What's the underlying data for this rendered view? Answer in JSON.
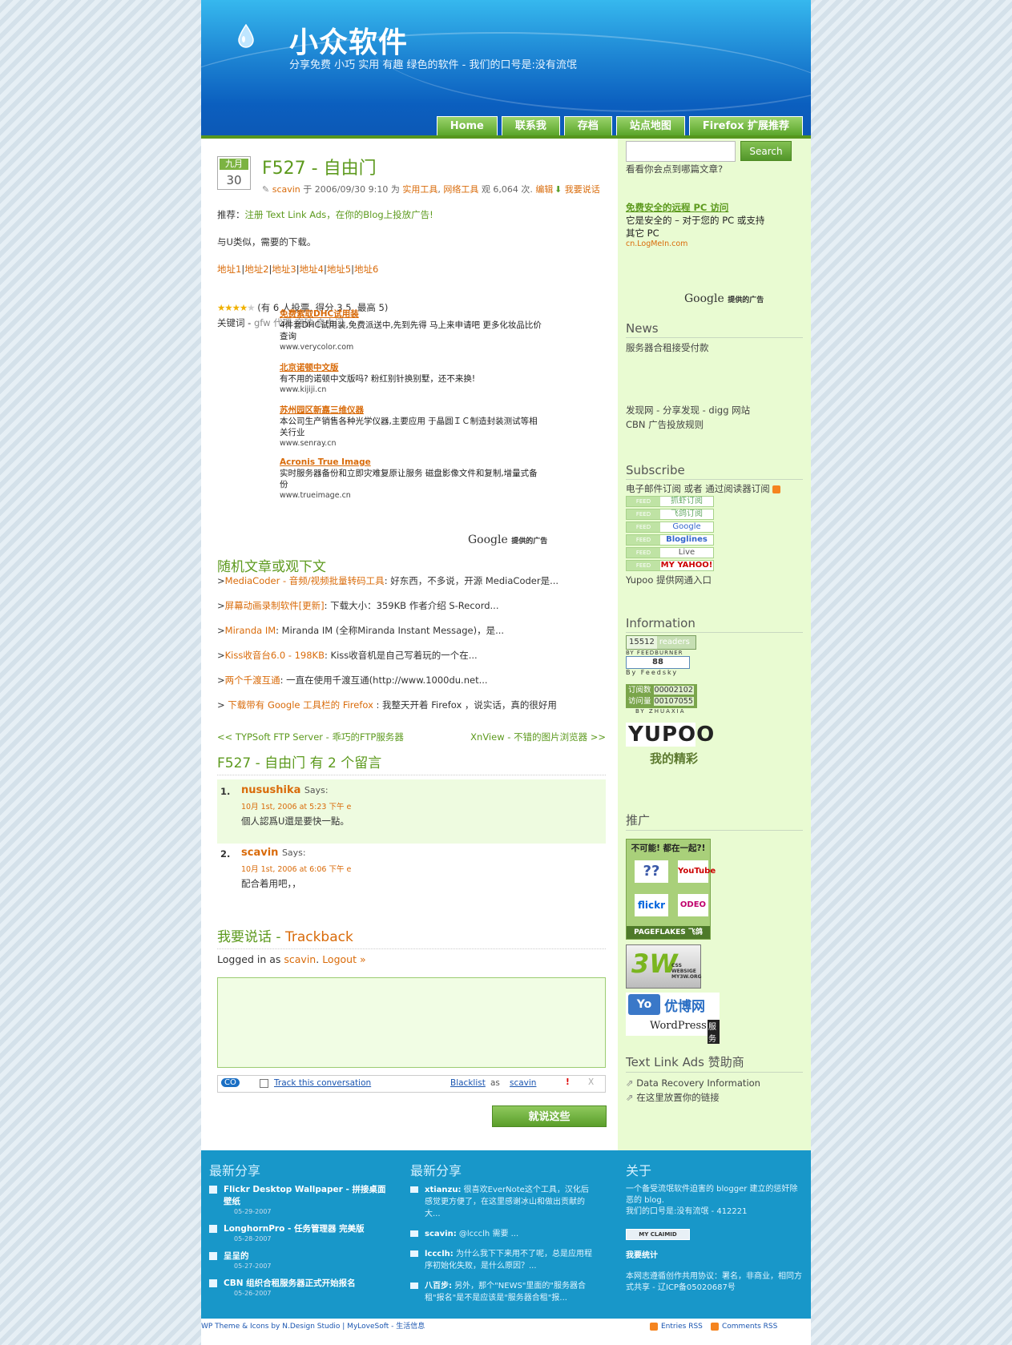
{
  "header": {
    "title": "小众软件",
    "tagline": "分享免费 小巧 实用 有趣 绿色的软件 - 我们的口号是:没有流氓",
    "nav": [
      "Home",
      "联系我",
      "存档",
      "站点地图",
      "Firefox 扩展推荐"
    ]
  },
  "post": {
    "month": "九月",
    "day": "30",
    "title": "F527 - 自由门",
    "author": "scavin",
    "meta_on": "于 2006/09/30 9:10 为",
    "cat1": "实用工具",
    "cat2": "网络工具",
    "views": "观 6,064 次.",
    "edit": "编辑",
    "say": "我要说话",
    "promo_prefix": "推荐：",
    "promo_link": "注册 Text Link Ads，在你的Blog上投放广告!",
    "intro": "与U类似，需要的下载。",
    "downloads": [
      "地址1",
      "地址2",
      "地址3",
      "地址4",
      "地址5",
      "地址6"
    ],
    "rating": "(有 6 人投票, 得分 3.5 ,最高 5)",
    "tags_label": "关键词 -",
    "tags": "gfw 代理 突破 自由门"
  },
  "ads": [
    {
      "title": "免费索取DHC试用装",
      "text": "4件套DHC试用装,免费派送中,先到先得 马上来申请吧 更多化妆品比价查询",
      "url": "www.verycolor.com"
    },
    {
      "title": "北京诺顿中文版",
      "text": "有不用的诺顿中文版吗? 粉红别针换别墅，还不来换!",
      "url": "www.kijiji.cn"
    },
    {
      "title": "苏州园区新嘉三维仪器",
      "text": "本公司生产销售各种光学仪器,主要应用 于晶圆ＩＣ制造封装测试等相关行业",
      "url": "www.senray.cn"
    },
    {
      "title": "Acronis True Image",
      "text": "实时服务器备份和立即灾难复原让服务 磁盘影像文件和复制,增量式备份",
      "url": "www.trueimage.cn"
    }
  ],
  "google_ads": "提供的广告",
  "google_word": "Google",
  "random": {
    "title": "随机文章或观下文",
    "items": [
      {
        "link": "MediaCoder - 音频/视频批量转码工具",
        "text": ": 好东西，不多说，开源 MediaCoder是..."
      },
      {
        "link": "屏幕动画录制软件[更新]",
        "text": ": 下载大小：359KB 作者介绍 S-Record..."
      },
      {
        "link": "Miranda IM",
        "text": ": Miranda IM (全称Miranda Instant Message)，是..."
      },
      {
        "link": "Kiss收音台6.0 - 198KB",
        "text": ": Kiss收音机是自己写着玩的一个在..."
      },
      {
        "link": "两个千渡互通",
        "text": ": 一直在使用千渡互通(http://www.1000du.net..."
      },
      {
        "link": " 下载带有 Google 工具栏的 Firefox ",
        "text": ": 我整天开着 Firefox ，说实话，真的很好用"
      }
    ],
    "prev": "<< TYPSoft FTP Server - 乖巧的FTP服务器",
    "next": "XnView - 不错的图片浏览器 >>"
  },
  "comments": {
    "title": "F527 - 自由门 有 2 个留言",
    "says": "Says:",
    "items": [
      {
        "n": "1.",
        "author": "nusushika",
        "date": "10月 1st, 2006 at 5:23 下午 e",
        "text": "個人認爲U還是要快一點。"
      },
      {
        "n": "2.",
        "author": "scavin",
        "date": "10月 1st, 2006 at 6:06 下午 e",
        "text": "配合着用吧，，"
      }
    ]
  },
  "respond": {
    "title": "我要说话",
    "trackback": "Trackback",
    "logged": "Logged in as",
    "user": "scavin",
    "logout": "Logout »",
    "co": "CO",
    "track": "Track this conversation",
    "blacklist": "Blacklist",
    "as": "as",
    "excl": "!",
    "x": "X",
    "submit": "就说这些"
  },
  "sidebar": {
    "search_btn": "Search",
    "search_note": "看看你会点到哪篇文章?",
    "ad_title": "免费安全的远程 PC 访问",
    "ad_text": "它是安全的 – 对于您的 PC 或支持其它 PC",
    "ad_url": "cn.LogMeIn.com",
    "news": {
      "title": "News",
      "items": [
        "服务器合租接受付款",
        "发现网 - 分享发现 - digg 网站",
        "CBN 广告投放规则"
      ]
    },
    "subscribe": {
      "title": "Subscribe",
      "line": "电子邮件订阅 或者 通过阅读器订阅",
      "feeds": [
        "抓虾订阅",
        "飞鸽订阅",
        "Google",
        "Bloglines",
        "Live",
        "MY YAHOO!"
      ],
      "feed": "FEED",
      "yupoo": "Yupoo 提供网通入口"
    },
    "info": {
      "title": "Information",
      "readers": "15512",
      "readers_label": "readers",
      "by_fb": "BY FEEDBURNER",
      "fs_num": "88",
      "by_fs": "By Feedsky",
      "dy": "订阅数",
      "dy_val": "00002102",
      "fw": "访问量",
      "fw_val": "00107055",
      "by_zx": "BY ZHUAXIA",
      "yupoo_logo": "YUPOO",
      "jc": "我的精彩"
    },
    "promote": {
      "title": "推广",
      "head": "不可能! 都在一起?!",
      "q": "??",
      "yt": "YouTube",
      "fl": "flickr",
      "ode": "ODEO",
      "pf": "PAGEFLAKES 飞鸽",
      "w3": "3W",
      "w3sub": "CSS WEBSIGE MY3W.ORG",
      "yo": "优博网",
      "wp": "WordPress",
      "wpfw": "服务"
    },
    "tla": {
      "title": "Text Link Ads 赞助商",
      "items": [
        "Data Recovery Information",
        "在这里放置你的链接"
      ]
    }
  },
  "footer": {
    "c1": {
      "title": "最新分享",
      "items": [
        {
          "t": "Flickr Desktop Wallpaper - 拼接桌面壁纸",
          "d": "05-29-2007"
        },
        {
          "t": "LonghornPro - 任务管理器 完美版",
          "d": "05-28-2007"
        },
        {
          "t": "呈呈的",
          "d": "05-27-2007"
        },
        {
          "t": "CBN 组织合租服务器正式开始报名",
          "d": "05-26-2007"
        }
      ]
    },
    "c2": {
      "title": "最新分享",
      "items": [
        {
          "a": "xtianzu:",
          "t": " 很喜欢EverNote这个工具，汉化后感觉更方便了，在这里感谢冰山和做出贡献的大..."
        },
        {
          "a": "scavin:",
          "t": " @lccclh 需要 ..."
        },
        {
          "a": "lccclh:",
          "t": " 为什么我下下来用不了呢，总是应用程序初始化失败，是什么原因？..."
        },
        {
          "a": "八百步:",
          "t": " 另外，那个\"NEWS\"里面的\"服务器合租\"报名\"是不是应该是\"服务器合租\"报..."
        }
      ]
    },
    "c3": {
      "title": "关于",
      "text": "一个备受流氓软件迫害的 blogger 建立的惩奸除恶的 blog.",
      "qq": "我们的口号是:没有流氓 - 412221",
      "claim": "MY CLAIMID",
      "stats": "我要统计",
      "license": "本网志遵循创作共用协议：署名，非商业，相同方式共享 - 辽ICP备05020687号"
    }
  },
  "bottom": {
    "left": "WP Theme & Icons by N.Design Studio | MyLoveSoft - 生活信息",
    "entries": "Entries RSS",
    "comments": "Comments RSS"
  }
}
